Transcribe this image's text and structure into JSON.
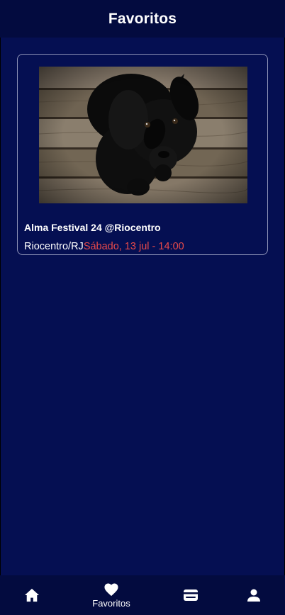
{
  "header": {
    "title": "Favoritos"
  },
  "favorites": [
    {
      "title": "Alma Festival 24 @Riocentro",
      "location": "Riocentro/RJ",
      "date": "Sábado, 13 jul - 14:00",
      "image_icon": "puppy-photo"
    }
  ],
  "bottom_nav": {
    "items": [
      {
        "icon": "home-icon",
        "label": ""
      },
      {
        "icon": "heart-icon",
        "label": "Favoritos",
        "active": true
      },
      {
        "icon": "ticket-icon",
        "label": ""
      },
      {
        "icon": "person-icon",
        "label": ""
      }
    ]
  },
  "colors": {
    "background": "#050f52",
    "bar": "#030b3f",
    "date_accent": "#e84a4a",
    "card_border": "#8f94b8"
  }
}
